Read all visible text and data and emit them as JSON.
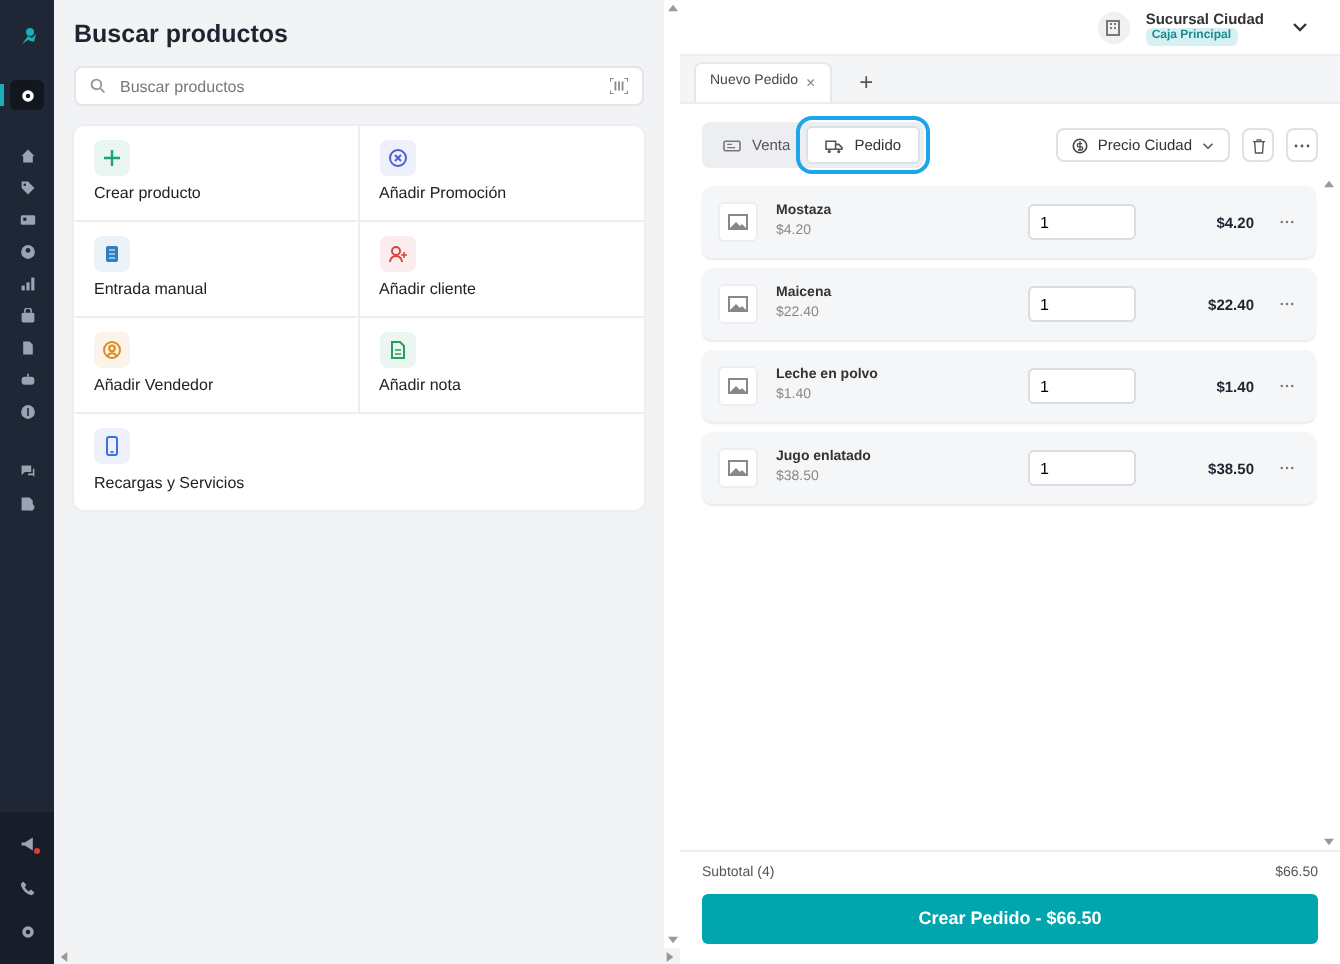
{
  "sidebar": {
    "items": [
      {
        "kind": "gear",
        "selected": true
      },
      {
        "kind": "home",
        "selected": false
      },
      {
        "kind": "tag",
        "selected": false
      },
      {
        "kind": "card",
        "selected": false
      },
      {
        "kind": "user",
        "selected": false
      },
      {
        "kind": "chart",
        "selected": false
      },
      {
        "kind": "bag",
        "selected": false
      },
      {
        "kind": "doc",
        "selected": false
      },
      {
        "kind": "robot",
        "selected": false
      },
      {
        "kind": "coin",
        "selected": false
      },
      {
        "kind": "chat",
        "selected": false
      },
      {
        "kind": "userdoc",
        "selected": false
      }
    ],
    "bottom_items": [
      {
        "kind": "megaphone",
        "alert": true
      },
      {
        "kind": "phone",
        "alert": false
      },
      {
        "kind": "gear",
        "alert": false
      }
    ]
  },
  "header": {
    "branch": "Sucursal Ciudad",
    "register": "Caja Principal"
  },
  "search_panel": {
    "title": "Buscar productos",
    "search": {
      "placeholder": "Buscar productos"
    },
    "actions": [
      {
        "label": "Crear producto",
        "kind": "plus",
        "color": "#1aa37a"
      },
      {
        "label": "Añadir Promoción",
        "kind": "promo",
        "color": "#4f5bd5"
      },
      {
        "label": "Entrada manual",
        "kind": "manual",
        "color": "#2f7fc1"
      },
      {
        "label": "Añadir cliente",
        "kind": "client",
        "color": "#d9453d"
      },
      {
        "label": "Añadir Vendedor",
        "kind": "seller",
        "color": "#e08a1e"
      },
      {
        "label": "Añadir nota",
        "kind": "note",
        "color": "#23a05a"
      },
      {
        "label": "Recargas y Servicios",
        "kind": "phone",
        "color": "#3a6fe0"
      }
    ]
  },
  "tabs": [
    {
      "label": "Nuevo Pedido",
      "close": "×"
    }
  ],
  "new_tab": "+",
  "mode": [
    {
      "label": "Venta",
      "kind": "sale",
      "selected": false,
      "highlighted": false
    },
    {
      "label": "Pedido",
      "kind": "truck",
      "selected": true,
      "highlighted": true
    }
  ],
  "price_list": "Precio Ciudad",
  "order_items": [
    {
      "name": "Mostaza",
      "price": "$4.20",
      "quantity": "1",
      "total": "$4.20"
    },
    {
      "name": "Maicena",
      "price": "$22.40",
      "quantity": "1",
      "total": "$22.40"
    },
    {
      "name": "Leche en polvo",
      "price": "$1.40",
      "quantity": "1",
      "total": "$1.40"
    },
    {
      "name": "Jugo enlatado",
      "price": "$38.50",
      "quantity": "1",
      "total": "$38.50"
    }
  ],
  "subtotal": {
    "label": "Subtotal (4)",
    "value": "$66.50"
  },
  "submit": "Crear Pedido - $66.50"
}
